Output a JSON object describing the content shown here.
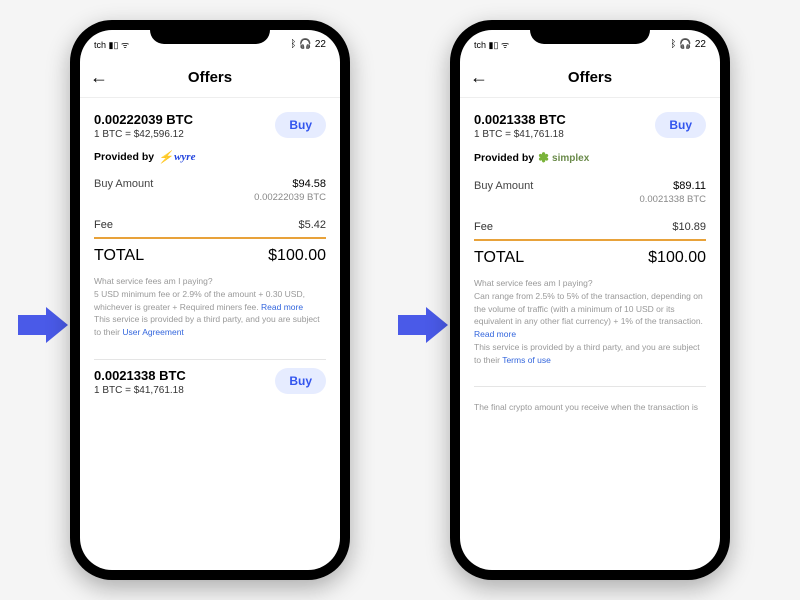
{
  "status": {
    "left_fragment": "tch",
    "right": "22"
  },
  "nav": {
    "title": "Offers"
  },
  "common": {
    "buy_label": "Buy",
    "provided_by": "Provided by",
    "buy_amount_label": "Buy Amount",
    "fee_label": "Fee",
    "total_label": "TOTAL",
    "disclaimer_q": "What service fees am I paying?",
    "read_more": "Read more",
    "third_party_prefix": "This service is provided by a third party, and you are subject to their "
  },
  "phone1": {
    "offer1": {
      "btc": "0.00222039 BTC",
      "rate": "1 BTC = $42,596.12",
      "provider": "wyre",
      "buy_amount": "$94.58",
      "buy_amount_btc": "0.00222039 BTC",
      "fee": "$5.42",
      "total": "$100.00",
      "fee_detail": "5 USD minimum fee or 2.9% of the amount + 0.30 USD, whichever is greater + Required miners fee.",
      "agreement_label": "User Agreement"
    },
    "offer2": {
      "btc": "0.0021338 BTC",
      "rate": "1 BTC = $41,761.18"
    }
  },
  "phone2": {
    "offer1": {
      "btc": "0.0021338 BTC",
      "rate": "1 BTC = $41,761.18",
      "provider": "simplex",
      "buy_amount": "$89.11",
      "buy_amount_btc": "0.0021338 BTC",
      "fee": "$10.89",
      "total": "$100.00",
      "fee_detail": "Can range from 2.5% to 5% of the transaction, depending on the volume of traffic (with a minimum of 10 USD or its equivalent in any other fiat currency) + 1% of the transaction.",
      "agreement_label": "Terms of use"
    },
    "footer_note": "The final crypto amount you receive when the transaction is"
  }
}
